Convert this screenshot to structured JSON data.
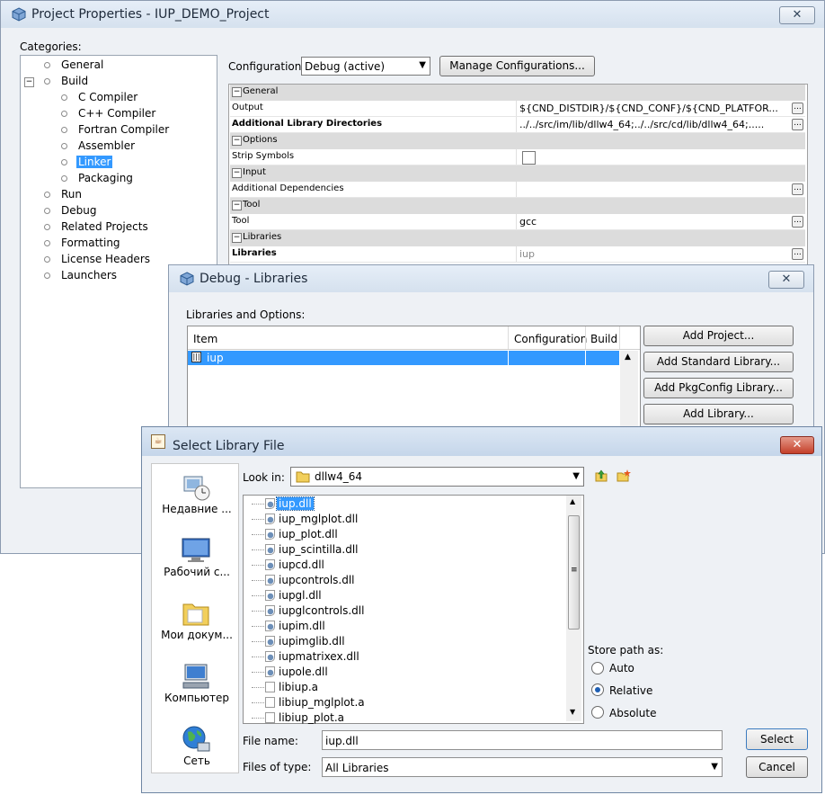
{
  "project_window": {
    "title": "Project Properties - IUP_DEMO_Project",
    "categories_label": "Categories:",
    "tree": [
      {
        "label": "General",
        "level": 0
      },
      {
        "label": "Build",
        "level": 0
      },
      {
        "label": "C Compiler",
        "level": 1
      },
      {
        "label": "C++ Compiler",
        "level": 1
      },
      {
        "label": "Fortran Compiler",
        "level": 1
      },
      {
        "label": "Assembler",
        "level": 1
      },
      {
        "label": "Linker",
        "level": 1,
        "selected": true
      },
      {
        "label": "Packaging",
        "level": 1
      },
      {
        "label": "Run",
        "level": 0
      },
      {
        "label": "Debug",
        "level": 0
      },
      {
        "label": "Related Projects",
        "level": 0
      },
      {
        "label": "Formatting",
        "level": 0
      },
      {
        "label": "License Headers",
        "level": 0
      },
      {
        "label": "Launchers",
        "level": 0
      }
    ],
    "configuration_label": "Configuration:",
    "configuration_value": "Debug (active)",
    "manage_button": "Manage Configurations...",
    "properties": [
      {
        "section": "General"
      },
      {
        "name": "Output",
        "value": "${CND_DISTDIR}/${CND_CONF}/${CND_PLATFOR..."
      },
      {
        "name": "Additional Library Directories",
        "value": "../../src/im/lib/dllw4_64;../../src/cd/lib/dllw4_64;.....",
        "bold": true
      },
      {
        "section": "Options"
      },
      {
        "name": "Strip Symbols",
        "value": ""
      },
      {
        "section": "Input"
      },
      {
        "name": "Additional Dependencies",
        "value": ""
      },
      {
        "section": "Tool"
      },
      {
        "name": "Tool",
        "value": "gcc"
      },
      {
        "section": "Libraries"
      },
      {
        "name": "Libraries",
        "value": "iup",
        "bold": true
      }
    ]
  },
  "debug_window": {
    "title": "Debug - Libraries",
    "libraries_label": "Libraries and Options:",
    "columns": [
      "Item",
      "Configuration",
      "Build"
    ],
    "rows": [
      {
        "item": "iup",
        "configuration": "",
        "build": ""
      }
    ],
    "buttons": [
      "Add Project...",
      "Add Standard Library...",
      "Add PkgConfig Library...",
      "Add Library..."
    ]
  },
  "file_dialog": {
    "title": "Select Library File",
    "sidebar": [
      "Недавние ...",
      "Рабочий с...",
      "Мои докум...",
      "Компьютер",
      "Сеть"
    ],
    "look_in_label": "Look in:",
    "look_in_value": "dllw4_64",
    "files": [
      "iup.dll",
      "iup_mglplot.dll",
      "iup_plot.dll",
      "iup_scintilla.dll",
      "iupcd.dll",
      "iupcontrols.dll",
      "iupgl.dll",
      "iupglcontrols.dll",
      "iupim.dll",
      "iupimglib.dll",
      "iupmatrixex.dll",
      "iupole.dll",
      "libiup.a",
      "libiup_mglplot.a",
      "libiup_plot.a"
    ],
    "store_path_label": "Store path as:",
    "store_options": [
      "Auto",
      "Relative",
      "Absolute"
    ],
    "store_selected": "Relative",
    "file_name_label": "File name:",
    "file_name_value": "iup.dll",
    "files_of_type_label": "Files of type:",
    "files_of_type_value": "All Libraries",
    "select_button": "Select",
    "cancel_button": "Cancel"
  },
  "colors": {
    "selection": "#3399ff",
    "title_bg": "#dbe6f3"
  }
}
